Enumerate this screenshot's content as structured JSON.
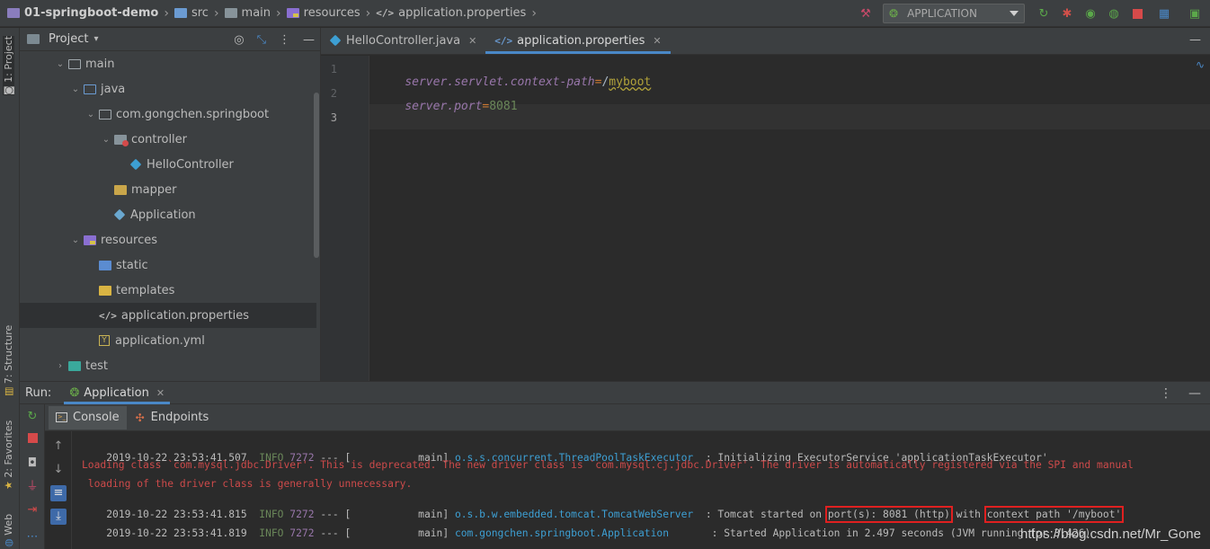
{
  "navbar": {
    "project": "01-springboot-demo",
    "crumbs": [
      "src",
      "main",
      "resources",
      "application.properties"
    ],
    "run_config": "APPLICATION"
  },
  "left_stripe": {
    "project_tab": "1: Project",
    "structure_tab": "7: Structure",
    "favorites_tab": "2: Favorites",
    "web_tab": "Web"
  },
  "project_panel": {
    "title": "Project",
    "tree": [
      {
        "label": "main"
      },
      {
        "label": "java"
      },
      {
        "label": "com.gongchen.springboot"
      },
      {
        "label": "controller"
      },
      {
        "label": "HelloController"
      },
      {
        "label": "mapper"
      },
      {
        "label": "Application"
      },
      {
        "label": "resources"
      },
      {
        "label": "static"
      },
      {
        "label": "templates"
      },
      {
        "label": "application.properties"
      },
      {
        "label": "application.yml"
      },
      {
        "label": "test"
      }
    ]
  },
  "editor": {
    "tabs": [
      {
        "label": "HelloController.java"
      },
      {
        "label": "application.properties"
      }
    ],
    "lines": [
      {
        "num": "1",
        "key": "server.servlet.context-path",
        "eq": "=",
        "val": "/",
        "val2": "myboot"
      },
      {
        "num": "2",
        "key": "server.port",
        "eq": "=",
        "val": "8081"
      },
      {
        "num": "3"
      }
    ]
  },
  "run": {
    "label": "Run:",
    "tab": "Application",
    "console_tab": "Console",
    "endpoints_tab": "Endpoints",
    "lines": [
      {
        "date": "2019-10-22 23:53:41.507",
        "level": "INFO",
        "pid": "7272",
        "thread": " --- [           main] ",
        "logger": "o.s.s.concurrent.ThreadPoolTaskExecutor ",
        "msg": " : Initializing ExecutorService 'applicationTaskExecutor'"
      },
      {
        "err": "Loading class `com.mysql.jdbc.Driver'. This is deprecated. The new driver class is `com.mysql.cj.jdbc.Driver'. The driver is automatically registered via the SPI and manual"
      },
      {
        "err": " loading of the driver class is generally unnecessary."
      },
      {
        "date": "2019-10-22 23:53:41.815",
        "level": "INFO",
        "pid": "7272",
        "thread": " --- [           main] ",
        "logger": "o.s.b.w.embedded.tomcat.TomcatWebServer ",
        "msg_pre": " : Tomcat started on ",
        "port": "port(s): 8081 (http)",
        "with": " with ",
        "ctx": "context path '/myboot'"
      },
      {
        "date": "2019-10-22 23:53:41.819",
        "level": "INFO",
        "pid": "7272",
        "thread": " --- [           main] ",
        "logger": "com.gongchen.springboot.Application      ",
        "msg": " : Started Application in 2.497 seconds (JVM running for 3.426)"
      }
    ]
  },
  "watermark": "https://blog.csdn.net/Mr_Gone"
}
